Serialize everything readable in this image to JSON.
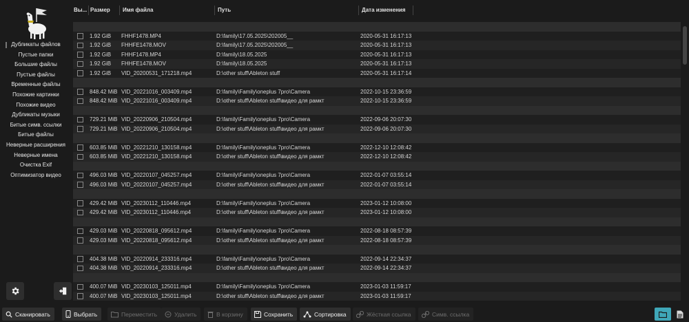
{
  "sidebar": {
    "items": [
      {
        "label": "Дубликаты файлов",
        "active": true
      },
      {
        "label": "Пустые папки"
      },
      {
        "label": "Большие файлы"
      },
      {
        "label": "Пустые файлы"
      },
      {
        "label": "Временные файлы"
      },
      {
        "label": "Похожие картинки"
      },
      {
        "label": "Похожие видео"
      },
      {
        "label": "Дубликаты музыки"
      },
      {
        "label": "Битые симв. ссылки"
      },
      {
        "label": "Битые файлы"
      },
      {
        "label": "Неверные расширения"
      },
      {
        "label": "Неверные имена"
      },
      {
        "label": "Очистка Exif"
      },
      {
        "label": "Оптимизатор видео"
      }
    ]
  },
  "table": {
    "headers": {
      "select": "Вы...",
      "size": "Размер",
      "name": "Имя файла",
      "path": "Путь",
      "date": "Дата изменения"
    },
    "groups": [
      [
        {
          "size": "1.92 GiB",
          "name": "FHHF1478.MP4",
          "path": "D:\\family\\17.05.2025\\202005__",
          "date": "2020-05-31 16:17:13"
        },
        {
          "size": "1.92 GiB",
          "name": "FHHFE1478.MOV",
          "path": "D:\\family\\17.05.2025\\202005__",
          "date": "2020-05-31 16:17:13"
        },
        {
          "size": "1.92 GiB",
          "name": "FHHF1478.MP4",
          "path": "D:\\family\\18.05.2025",
          "date": "2020-05-31 16:17:13"
        },
        {
          "size": "1.92 GiB",
          "name": "FHHFE1478.MOV",
          "path": "D:\\family\\18.05.2025",
          "date": "2020-05-31 16:17:13"
        },
        {
          "size": "1.92 GiB",
          "name": "VID_20200531_171218.mp4",
          "path": "D:\\other stuff\\Ableton stuff",
          "date": "2020-05-31 16:17:14"
        }
      ],
      [
        {
          "size": "848.42 MiB",
          "name": "VID_20221016_003409.mp4",
          "path": "D:\\family\\Family\\oneplus 7pro\\Camera",
          "date": "2022-10-15 23:36:59"
        },
        {
          "size": "848.42 MiB",
          "name": "VID_20221016_003409.mp4",
          "path": "D:\\other stuff\\Ableton stuff\\видео для рамкт",
          "date": "2022-10-15 23:36:59"
        }
      ],
      [
        {
          "size": "729.21 MiB",
          "name": "VID_20220906_210504.mp4",
          "path": "D:\\family\\Family\\oneplus 7pro\\Camera",
          "date": "2022-09-06 20:07:30"
        },
        {
          "size": "729.21 MiB",
          "name": "VID_20220906_210504.mp4",
          "path": "D:\\other stuff\\Ableton stuff\\видео для рамкт",
          "date": "2022-09-06 20:07:30"
        }
      ],
      [
        {
          "size": "603.85 MiB",
          "name": "VID_20221210_130158.mp4",
          "path": "D:\\family\\Family\\oneplus 7pro\\Camera",
          "date": "2022-12-10 12:08:42"
        },
        {
          "size": "603.85 MiB",
          "name": "VID_20221210_130158.mp4",
          "path": "D:\\other stuff\\Ableton stuff\\видео для рамкт",
          "date": "2022-12-10 12:08:42"
        }
      ],
      [
        {
          "size": "496.03 MiB",
          "name": "VID_20220107_045257.mp4",
          "path": "D:\\family\\Family\\oneplus 7pro\\Camera",
          "date": "2022-01-07 03:55:14"
        },
        {
          "size": "496.03 MiB",
          "name": "VID_20220107_045257.mp4",
          "path": "D:\\other stuff\\Ableton stuff\\видео для рамкт",
          "date": "2022-01-07 03:55:14"
        }
      ],
      [
        {
          "size": "429.42 MiB",
          "name": "VID_20230112_110446.mp4",
          "path": "D:\\family\\Family\\oneplus 7pro\\Camera",
          "date": "2023-01-12 10:08:00"
        },
        {
          "size": "429.42 MiB",
          "name": "VID_20230112_110446.mp4",
          "path": "D:\\other stuff\\Ableton stuff\\видео для рамкт",
          "date": "2023-01-12 10:08:00"
        }
      ],
      [
        {
          "size": "429.03 MiB",
          "name": "VID_20220818_095612.mp4",
          "path": "D:\\family\\Family\\oneplus 7pro\\Camera",
          "date": "2022-08-18 08:57:39"
        },
        {
          "size": "429.03 MiB",
          "name": "VID_20220818_095612.mp4",
          "path": "D:\\other stuff\\Ableton stuff\\видео для рамкт",
          "date": "2022-08-18 08:57:39"
        }
      ],
      [
        {
          "size": "404.38 MiB",
          "name": "VID_20220914_233316.mp4",
          "path": "D:\\family\\Family\\oneplus 7pro\\Camera",
          "date": "2022-09-14 22:34:37"
        },
        {
          "size": "404.38 MiB",
          "name": "VID_20220914_233316.mp4",
          "path": "D:\\other stuff\\Ableton stuff\\видео для рамкт",
          "date": "2022-09-14 22:34:37"
        }
      ],
      [
        {
          "size": "400.07 MiB",
          "name": "VID_20230103_125011.mp4",
          "path": "D:\\family\\Family\\oneplus 7pro\\Camera",
          "date": "2023-01-03 11:59:17"
        },
        {
          "size": "400.07 MiB",
          "name": "VID_20230103_125011.mp4",
          "path": "D:\\other stuff\\Ableton stuff\\видео для рамкт",
          "date": "2023-01-03 11:59:17"
        }
      ]
    ]
  },
  "toolbar": {
    "scan": "Сканировать",
    "select": "Выбрать",
    "move": "Переместить",
    "delete": "Удалить",
    "trash": "В корзину",
    "save": "Сохранить",
    "sort": "Сортировка",
    "hardlink": "Жёсткая ссылка",
    "symlink": "Симв. ссылка"
  },
  "colors": {
    "accent": "#3fa7b8",
    "background": "#1b1b1b"
  }
}
